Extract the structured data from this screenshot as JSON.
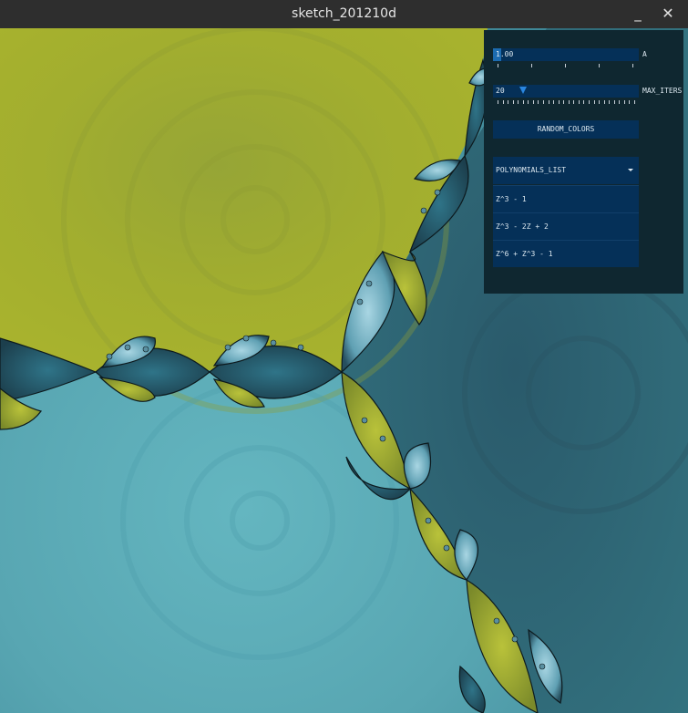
{
  "window": {
    "title": "sketch_201210d",
    "minimize_icon": "minimize-icon",
    "close_icon": "close-icon"
  },
  "controls": {
    "slider_a": {
      "value": "1.00",
      "label": "A",
      "fraction": 0.03
    },
    "slider_max_iters": {
      "value": "20",
      "label": "MAX_ITERS",
      "fraction": 0.2
    },
    "button_random_colors": "RANDOM_COLORS",
    "polynomials_list": {
      "label": "POLYNOMIALS_LIST",
      "items": [
        "Z^3 - 1",
        "Z^3 - 2Z + 2",
        "Z^6 + Z^3 - 1"
      ]
    }
  },
  "colors": {
    "olive": "#a6b12f",
    "teal_dark": "#2c5f6f",
    "teal_light": "#5fb0bb",
    "panel_bg": "#0f2730",
    "control_bg": "#053058",
    "control_fill": "#1c6bb0"
  }
}
